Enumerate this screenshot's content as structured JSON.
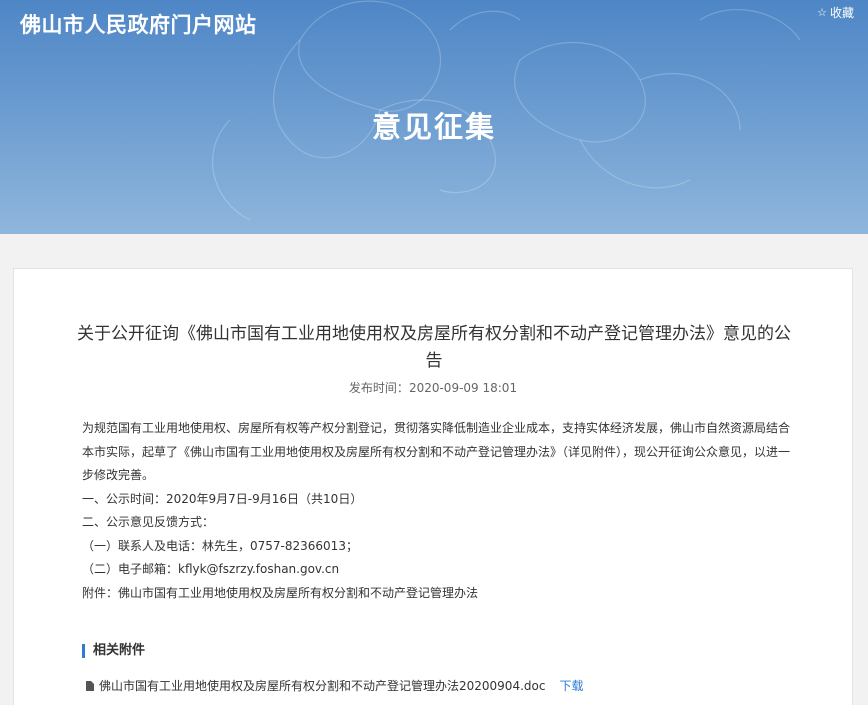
{
  "header": {
    "site_title": "佛山市人民政府门户网站",
    "favorite_label": "收藏",
    "favorite_icon": "star-icon",
    "page_heading": "意见征集"
  },
  "article": {
    "title": "关于公开征询《佛山市国有工业用地使用权及房屋所有权分割和不动产登记管理办法》意见的公告",
    "publish_label": "发布时间：",
    "publish_time": "2020-09-09 18:01",
    "paragraphs": [
      "为规范国有工业用地使用权、房屋所有权等产权分割登记，贯彻落实降低制造业企业成本，支持实体经济发展，佛山市自然资源局结合本市实际，起草了《佛山市国有工业用地使用权及房屋所有权分割和不动产登记管理办法》（详见附件），现公开征询公众意见，以进一步修改完善。",
      "一、公示时间：2020年9月7日-9月16日（共10日）",
      "二、公示意见反馈方式：",
      "（一）联系人及电话：林先生，0757-82366013；",
      "（二）电子邮箱：kflyk@fszrzy.foshan.gov.cn",
      "附件：佛山市国有工业用地使用权及房屋所有权分割和不动产登记管理办法"
    ]
  },
  "attachments": {
    "heading": "相关附件",
    "items": [
      {
        "icon": "document-icon",
        "name": "佛山市国有工业用地使用权及房屋所有权分割和不动产登记管理办法20200904.doc",
        "action": "下载"
      }
    ]
  },
  "colors": {
    "banner_top": "#4e86c6",
    "banner_bottom": "#8fb6dc",
    "accent": "#2d7bd6",
    "background": "#f2f2f2"
  }
}
